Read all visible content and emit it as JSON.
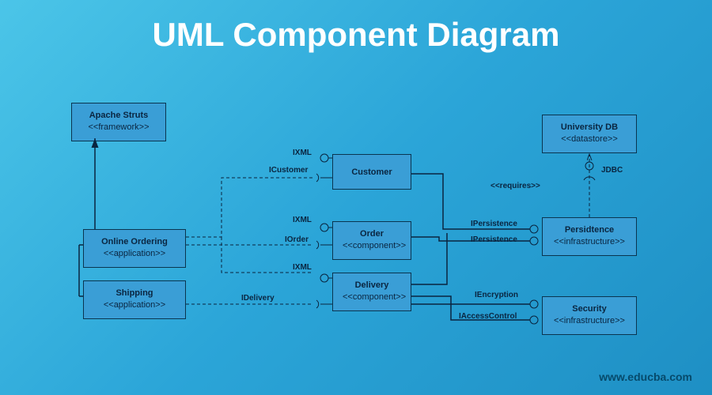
{
  "title": "UML Component Diagram",
  "watermark": "www.educba.com",
  "components": {
    "apache": {
      "name": "Apache Struts",
      "stereo": "<<framework>>"
    },
    "online": {
      "name": "Online Ordering",
      "stereo": "<<application>>"
    },
    "shipping": {
      "name": "Shipping",
      "stereo": "<<application>>"
    },
    "customer": {
      "name": "Customer",
      "stereo": ""
    },
    "order": {
      "name": "Order",
      "stereo": "<<component>>"
    },
    "delivery": {
      "name": "Delivery",
      "stereo": "<<component>>"
    },
    "university": {
      "name": "University DB",
      "stereo": "<<datastore>>"
    },
    "persistence": {
      "name": "Persidtence",
      "stereo": "<<infrastructure>>"
    },
    "security": {
      "name": "Security",
      "stereo": "<<infrastructure>>"
    }
  },
  "labels": {
    "ixml1": "IXML",
    "icustomer": "ICustomer",
    "ixml2": "IXML",
    "iorder": "IOrder",
    "ixml3": "IXML",
    "idelivery": "IDelivery",
    "ipersistence1": "IPersistence",
    "ipersistence2": "IPersistence",
    "iencryption": "IEncryption",
    "iaccesscontrol": "IAccessControl",
    "jdbc": "JDBC",
    "requires": "<<requires>>"
  }
}
